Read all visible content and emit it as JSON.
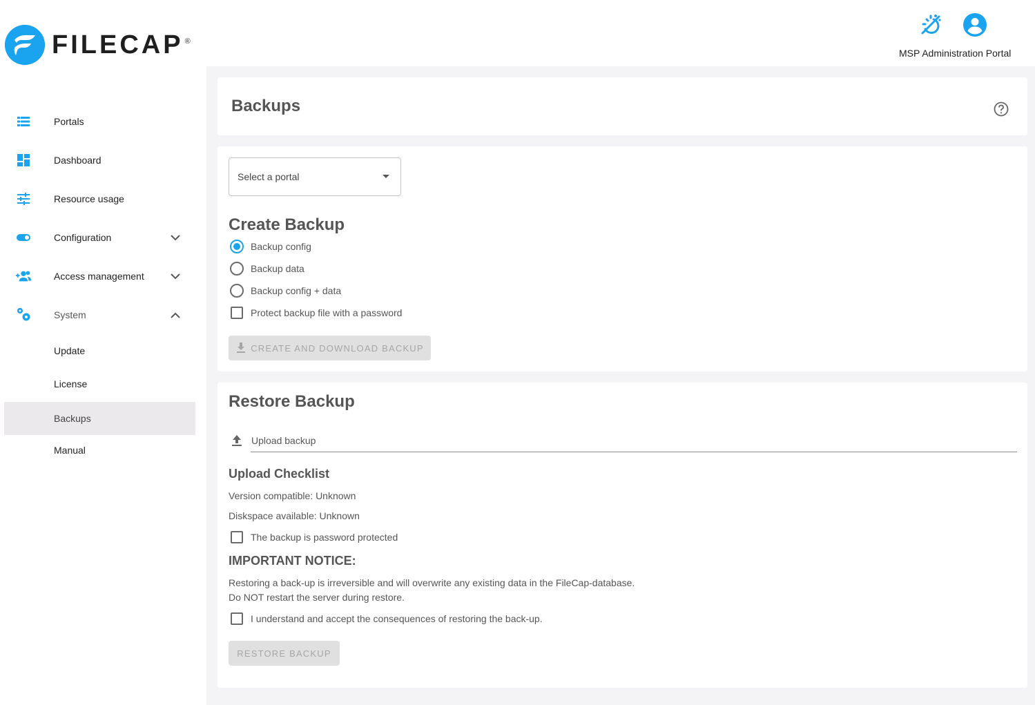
{
  "brand": {
    "name": "FILECAP",
    "reg_mark": "®"
  },
  "header": {
    "portal_label": "MSP Administration Portal"
  },
  "colors": {
    "accent": "#1aa3ee",
    "active_nav": "#ebe9ec",
    "background": "#f4f3f5"
  },
  "sidebar": {
    "items": [
      {
        "label": "Portals",
        "icon": "list-icon"
      },
      {
        "label": "Dashboard",
        "icon": "dashboard-icon"
      },
      {
        "label": "Resource usage",
        "icon": "tune-icon"
      },
      {
        "label": "Configuration",
        "icon": "toggle-icon"
      },
      {
        "label": "Access management",
        "icon": "group-add-icon"
      },
      {
        "label": "System",
        "icon": "settings-icon"
      }
    ],
    "subitems": [
      {
        "label": "Update"
      },
      {
        "label": "License"
      },
      {
        "label": "Backups"
      },
      {
        "label": "Manual"
      }
    ]
  },
  "page": {
    "title": "Backups"
  },
  "portal_select": {
    "placeholder": "Select a portal"
  },
  "create": {
    "title": "Create Backup",
    "options": [
      {
        "label": "Backup config",
        "selected": true
      },
      {
        "label": "Backup data",
        "selected": false
      },
      {
        "label": "Backup config + data",
        "selected": false
      }
    ],
    "password_label": "Protect backup file with a password",
    "button_label": "CREATE AND DOWNLOAD BACKUP"
  },
  "restore": {
    "title": "Restore Backup",
    "upload_label": "Upload backup",
    "checklist_title": "Upload Checklist",
    "version_text": "Version compatible: Unknown",
    "diskspace_text": "Diskspace available: Unknown",
    "password_protected_label": "The backup is password protected",
    "notice_title": "IMPORTANT NOTICE:",
    "notice_line1": "Restoring a back-up is irreversible and will overwrite any existing data in the FileCap-database.",
    "notice_line2": "Do NOT restart the server during restore.",
    "accept_label": "I understand and accept the consequences of restoring the back-up.",
    "button_label": "RESTORE BACKUP"
  }
}
